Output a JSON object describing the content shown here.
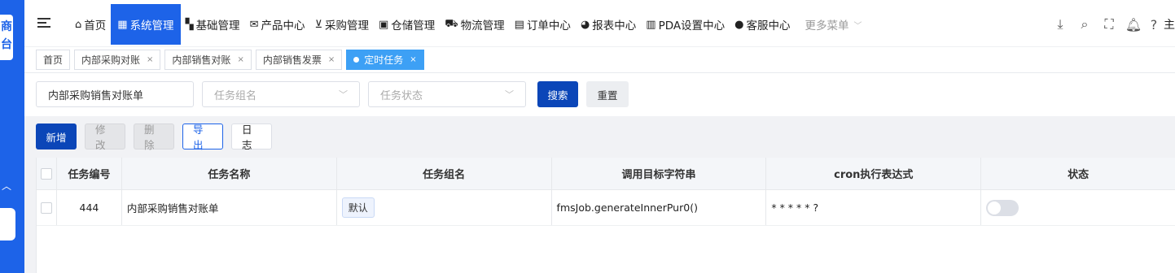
{
  "sidebar": {
    "logo_text": "商\n台",
    "collapse_icon": "chevron-up-icon"
  },
  "nav": {
    "items": [
      {
        "label": "首页",
        "icon": "home-icon",
        "glyph": "⌂"
      },
      {
        "label": "系统管理",
        "icon": "sitemap-icon",
        "glyph": "▦",
        "active": true
      },
      {
        "label": "基础管理",
        "icon": "grid-icon",
        "glyph": "▚"
      },
      {
        "label": "产品中心",
        "icon": "mail-icon",
        "glyph": "✉"
      },
      {
        "label": "采购管理",
        "icon": "cart-icon",
        "glyph": "⊻"
      },
      {
        "label": "仓储管理",
        "icon": "box-icon",
        "glyph": "▣"
      },
      {
        "label": "物流管理",
        "icon": "truck-icon",
        "glyph": "⛟"
      },
      {
        "label": "订单中心",
        "icon": "table-icon",
        "glyph": "▤"
      },
      {
        "label": "报表中心",
        "icon": "pie-chart-icon",
        "glyph": "◕"
      },
      {
        "label": "PDA设置中心",
        "icon": "calculator-icon",
        "glyph": "▥"
      },
      {
        "label": "客服中心",
        "icon": "user-icon",
        "glyph": "●"
      }
    ],
    "more_label": "更多菜单"
  },
  "tools": {
    "user_label": "主"
  },
  "tabs": [
    {
      "label": "首页"
    },
    {
      "label": "内部采购对账"
    },
    {
      "label": "内部销售对账"
    },
    {
      "label": "内部销售发票"
    },
    {
      "label": "定时任务",
      "active": true
    }
  ],
  "search": {
    "job_name_value": "内部采购销售对账单",
    "job_group_placeholder": "任务组名",
    "job_status_placeholder": "任务状态",
    "search_label": "搜索",
    "reset_label": "重置"
  },
  "toolbar": {
    "add_label": "新增",
    "edit_label": "修改",
    "delete_label": "删除",
    "export_label": "导出",
    "log_label": "日志"
  },
  "table": {
    "columns": [
      "任务编号",
      "任务名称",
      "任务组名",
      "调用目标字符串",
      "cron执行表达式",
      "状态"
    ],
    "rows": [
      {
        "id": "444",
        "name": "内部采购销售对账单",
        "group": "默认",
        "target": "fmsJob.generateInnerPur0()",
        "cron": "* * * * * ?",
        "status_on": false
      }
    ]
  },
  "colors": {
    "primary": "#1d63e8",
    "button_dark": "#0b46b8",
    "active_tab": "#3da0f5"
  }
}
